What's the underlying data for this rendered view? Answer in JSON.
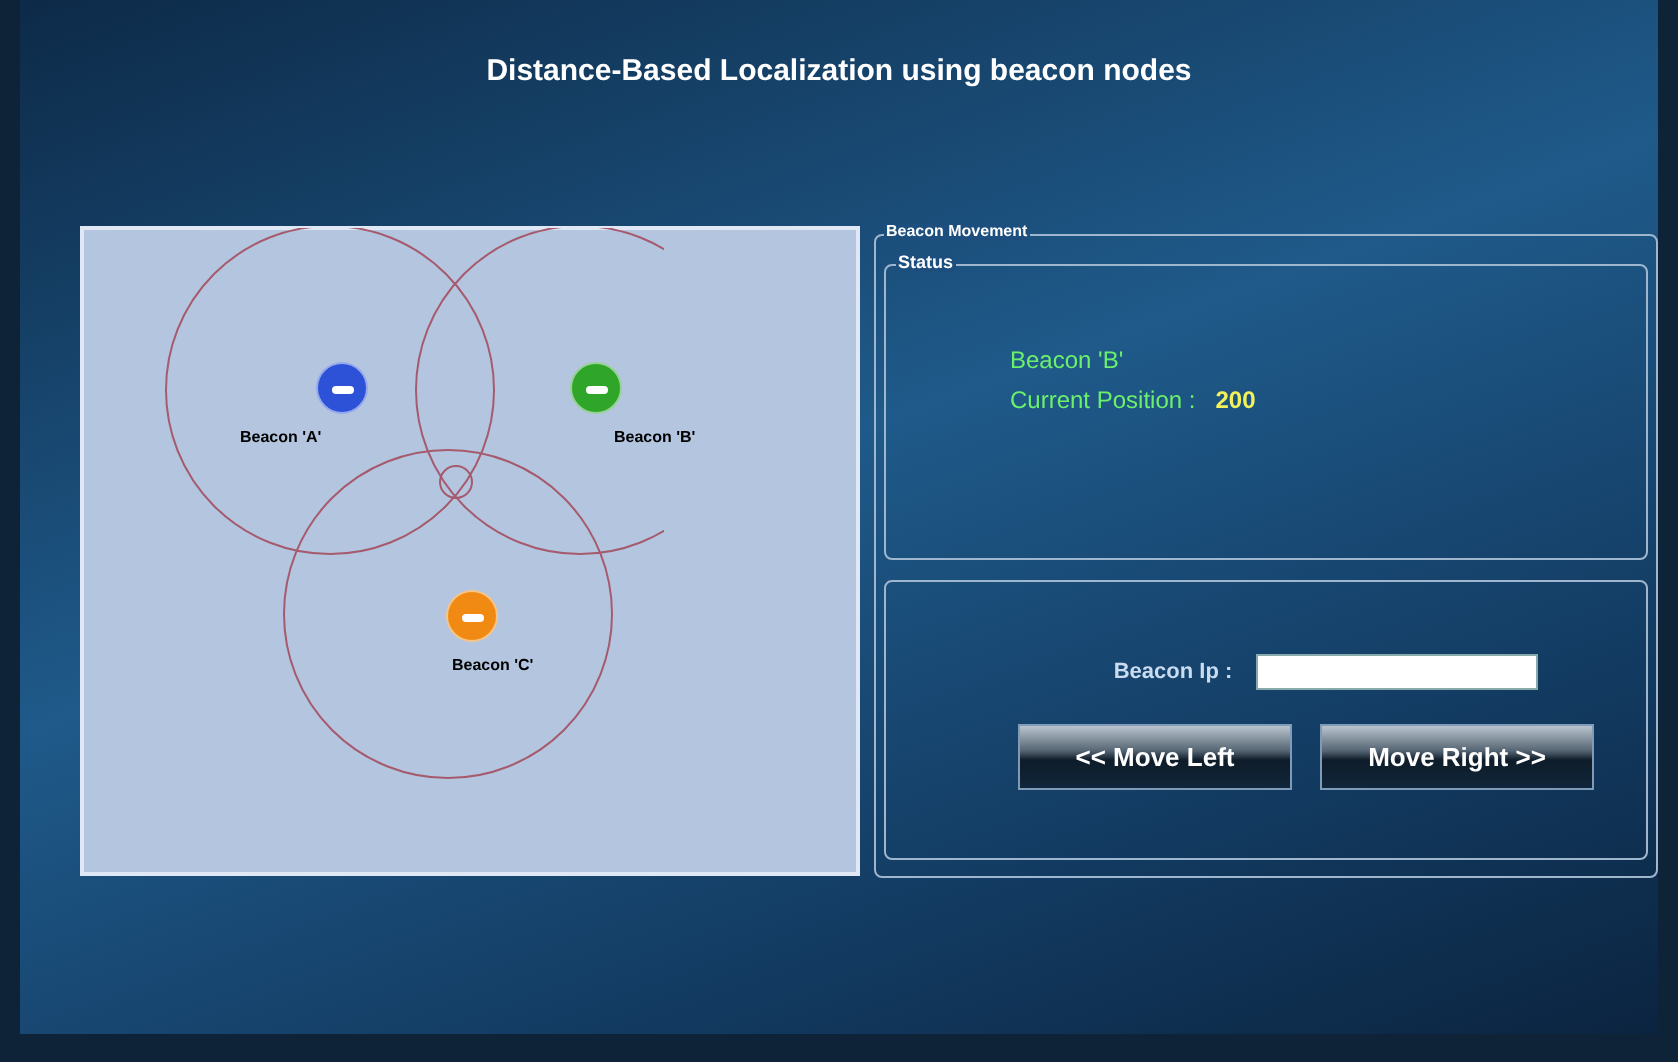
{
  "title": "Distance-Based Localization using beacon nodes",
  "beacons": [
    {
      "label": "Beacon 'A'",
      "color": "#2d52d8"
    },
    {
      "label": "Beacon 'B'",
      "color": "#2fa52a"
    },
    {
      "label": "Beacon 'C'",
      "color": "#f08a12"
    }
  ],
  "beacon_movement": {
    "title": "Beacon Movement",
    "status": {
      "title": "Status",
      "beacon": "Beacon 'B'",
      "position_label": "Current Position :",
      "position_value": "200"
    },
    "input_label": "Beacon Ip :",
    "buttons": [
      "<< Move Left",
      "Move Right >>"
    ]
  }
}
